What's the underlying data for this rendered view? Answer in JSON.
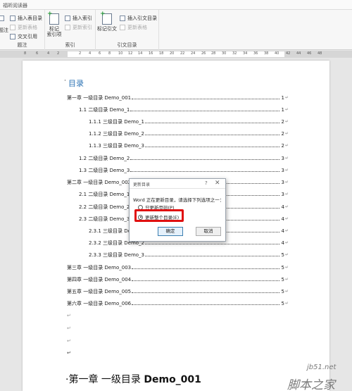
{
  "app": {
    "tab_label": "福昕阅读器"
  },
  "ribbon": {
    "footnote_group": {
      "label": "题注",
      "left_partial_label": "题注",
      "insert_table_of_figures": "插入表目录",
      "update_table": "更新表格",
      "cross_reference": "交叉引用"
    },
    "index_group": {
      "label": "索引",
      "mark_entry": "标记\n索引项",
      "insert_index": "插入索引",
      "update_index": "更新索引"
    },
    "citation_group": {
      "label": "引文目录",
      "mark_citation": "标记引文",
      "insert_table_of_authorities": "插入引文目录",
      "update_table": "更新表格"
    }
  },
  "ruler": {
    "ticks": [
      "8",
      "6",
      "4",
      "2",
      "2",
      "4",
      "6",
      "8",
      "10",
      "12",
      "14",
      "16",
      "18",
      "20",
      "22",
      "24",
      "26",
      "28",
      "30",
      "32",
      "34",
      "36",
      "38",
      "40",
      "42",
      "44",
      "46",
      "48"
    ]
  },
  "document": {
    "toc_title": "目录",
    "toc_entries": [
      {
        "text": "第一章  一级目录 Demo_001",
        "page": "1"
      },
      {
        "text": "1.1  二级目录 Demo_1",
        "page": "1"
      },
      {
        "text": "1.1.1  三级目录  Demo_1",
        "page": "2"
      },
      {
        "text": "1.1.2  三级目录  Demo_2",
        "page": "2"
      },
      {
        "text": "1.1.3  三级目录  Demo_3",
        "page": "2"
      },
      {
        "text": "1.2  二级目录 Demo_2",
        "page": "3"
      },
      {
        "text": "1.3  二级目录 Demo_3",
        "page": "3"
      },
      {
        "text": "第二章  一级目录 Demo_002",
        "page": "3"
      },
      {
        "text": "2.1  二级目录 Demo_1",
        "page": "3"
      },
      {
        "text": "2.2  二级目录 Demo_2",
        "page": "4"
      },
      {
        "text": "2.3  二级目录 Demo_3",
        "page": "4"
      },
      {
        "text": "2.3.1  三级目录 Demo_1",
        "page": "4"
      },
      {
        "text": "2.3.2  三级目录  Demo_2",
        "page": "4"
      },
      {
        "text": "2.3.3  三级目录  Demo_3",
        "page": "5"
      },
      {
        "text": "第三章  一级目录 Demo_003",
        "page": "5"
      },
      {
        "text": "第四章  一级目录 Demo_004",
        "page": "5"
      },
      {
        "text": "第五章  一级目录 Demo_005",
        "page": "5"
      },
      {
        "text": "第六章  一级目录 Demo_006",
        "page": "5"
      }
    ],
    "paragraph_mark": "↵",
    "heading_prefix": "·第一章  一级目录 ",
    "heading_bold": "Demo_001"
  },
  "dialog": {
    "title": "更新目录",
    "help": "?",
    "close": "✕",
    "prompt": "Word 正在更新目录，请选择下列选项之一：",
    "option_page_numbers": "只更新页码(P)",
    "option_entire_table": "更新整个目录(E)",
    "selected_option": "entire_table",
    "ok_label": "确定",
    "cancel_label": "取消",
    "highlight_color": "#e01010"
  },
  "watermark": {
    "url": "jb51.net",
    "name": "脚本之家"
  }
}
